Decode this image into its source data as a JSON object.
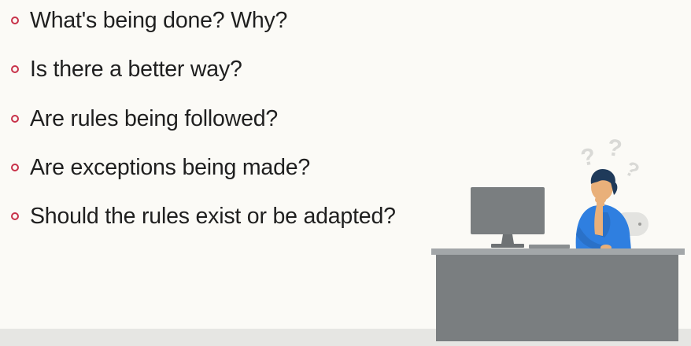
{
  "bullets": [
    {
      "text": "What's being done? Why?"
    },
    {
      "text": "Is there a better way?"
    },
    {
      "text": "Are rules being followed?"
    },
    {
      "text": "Are exceptions being made?"
    },
    {
      "text": "Should the rules exist or be adapted?"
    }
  ],
  "illustration": {
    "question_marks": [
      "?",
      "?",
      "?"
    ]
  },
  "colors": {
    "bullet_marker": "#c8324a",
    "desk": "#7a7e80",
    "monitor": "#7a7e80",
    "shirt": "#2f7fe0",
    "skin": "#e9b07a",
    "hair": "#1f3a5a"
  }
}
